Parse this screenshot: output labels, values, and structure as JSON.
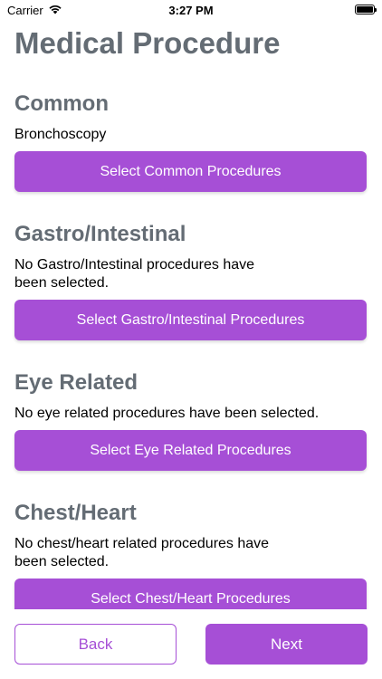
{
  "status_bar": {
    "carrier": "Carrier",
    "time": "3:27 PM",
    "wifi_icon": "wifi-icon",
    "battery_icon": "battery-icon"
  },
  "page": {
    "title": "Medical Procedure"
  },
  "sections": [
    {
      "heading": "Common",
      "text": "Bronchoscopy",
      "button_label": "Select Common Procedures"
    },
    {
      "heading": "Gastro/Intestinal",
      "text": "No Gastro/Intestinal procedures have\nbeen selected.",
      "button_label": "Select Gastro/Intestinal Procedures"
    },
    {
      "heading": "Eye Related",
      "text": "No eye related procedures have been selected.",
      "button_label": "Select Eye Related Procedures"
    },
    {
      "heading": "Chest/Heart",
      "text": "No chest/heart related procedures have\nbeen selected.",
      "button_label": "Select Chest/Heart Procedures"
    }
  ],
  "footer": {
    "back_label": "Back",
    "next_label": "Next"
  },
  "colors": {
    "accent": "#a64fd6",
    "heading": "#646c74"
  }
}
